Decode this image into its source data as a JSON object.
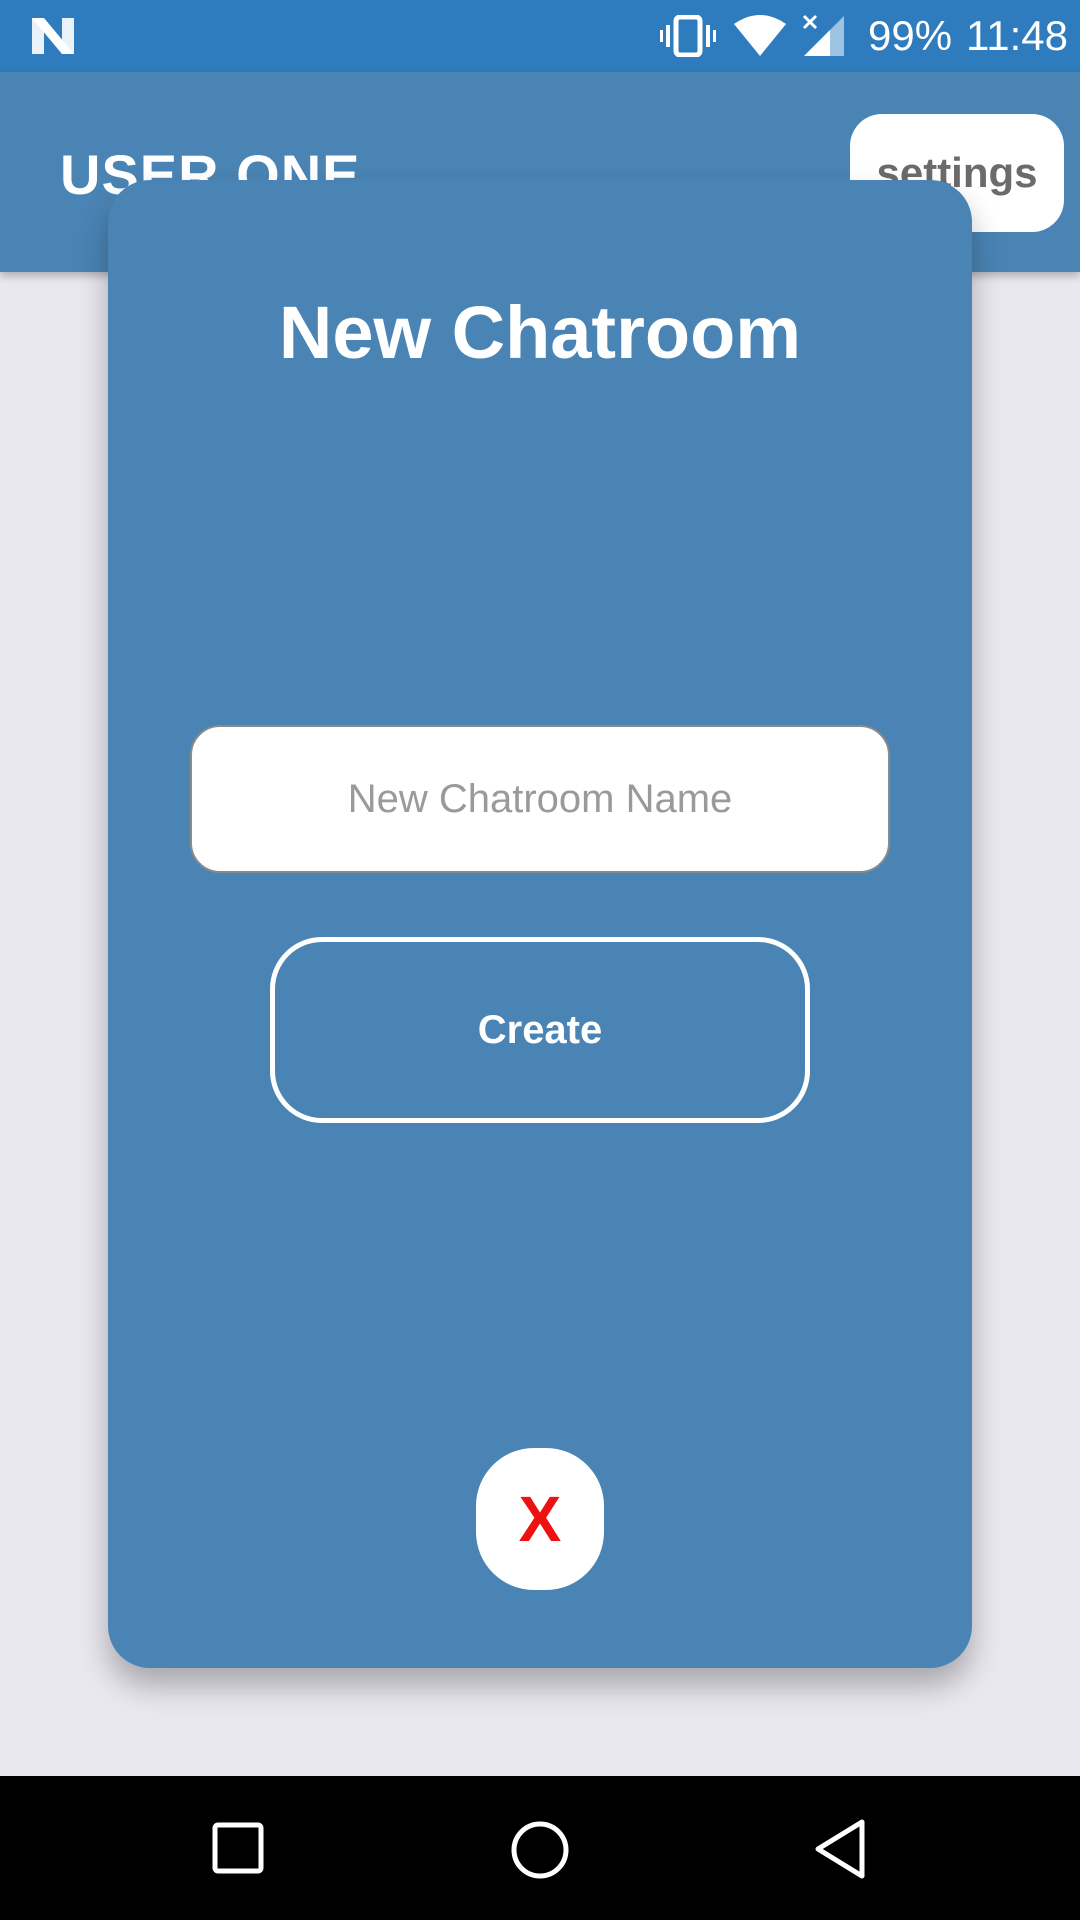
{
  "status_bar": {
    "battery": "99%",
    "time": "11:48",
    "icons": [
      "n-logo-icon",
      "vibrate-icon",
      "wifi-icon",
      "signal-icon"
    ]
  },
  "app_bar": {
    "title": "USER ONE",
    "settings_label": "settings"
  },
  "modal": {
    "title": "New Chatroom",
    "input_placeholder": "New Chatroom Name",
    "input_value": "",
    "create_label": "Create",
    "close_label": "X"
  },
  "nav_bar": {
    "icons": [
      "recents-icon",
      "home-icon",
      "back-icon"
    ]
  },
  "colors": {
    "status_bar": "#2e7bbd",
    "app_bar": "#4a84b4",
    "modal": "#4a84b4",
    "background": "#e9e8ef",
    "close_x": "#ee1111"
  }
}
